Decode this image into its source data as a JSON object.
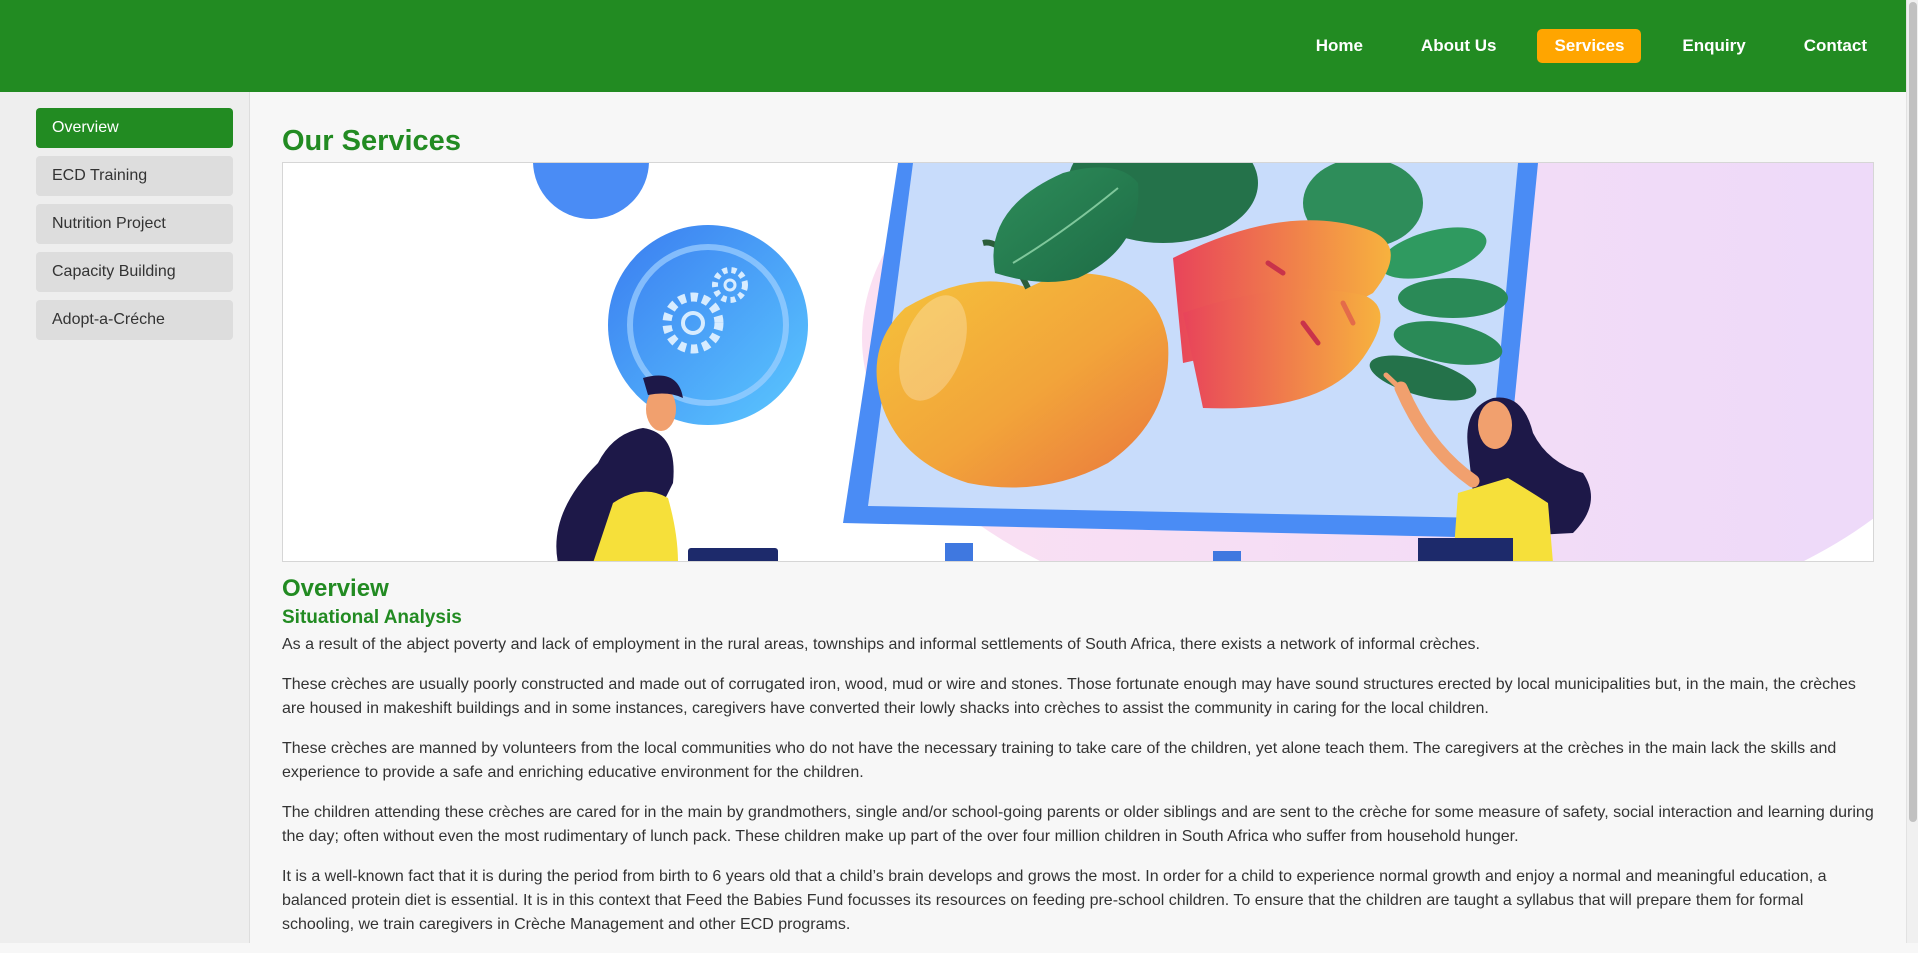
{
  "nav": {
    "items": [
      {
        "label": "Home",
        "active": false
      },
      {
        "label": "About Us",
        "active": false
      },
      {
        "label": "Services",
        "active": true
      },
      {
        "label": "Enquiry",
        "active": false
      },
      {
        "label": "Contact",
        "active": false
      }
    ]
  },
  "sidebar": {
    "items": [
      {
        "label": "Overview",
        "active": true
      },
      {
        "label": "ECD Training",
        "active": false
      },
      {
        "label": "Nutrition Project",
        "active": false
      },
      {
        "label": "Capacity Building",
        "active": false
      },
      {
        "label": "Adopt-a-Créche",
        "active": false
      }
    ]
  },
  "main": {
    "title": "Our Services",
    "section_title": "Overview",
    "subsection_title": "Situational Analysis",
    "paragraphs": [
      "As a result of the abject poverty and lack of employment in the rural areas, townships and informal settlements of South Africa, there exists a network of informal crèches.",
      "These crèches are usually poorly constructed and made out of corrugated iron, wood, mud or wire and stones. Those fortunate enough may have sound structures erected by local municipalities but, in the main, the crèches are housed in makeshift buildings and in some instances, caregivers have converted their lowly shacks into crèches to assist the community in caring for the local children.",
      "These crèches are manned by volunteers from the local communities who do not have the necessary training to take care of the children, yet alone teach them. The caregivers at the crèches in the main lack the skills and experience to provide a safe and enriching educative environment for the children.",
      "The children attending these crèches are cared for in the main by grandmothers, single and/or school-going parents or older siblings and are sent to the crèche for some measure of safety, social interaction and learning during the day; often without even the most rudimentary of lunch pack. These children make up part of the over four million children in South Africa who suffer from household hunger.",
      "It is a well-known fact that it is during the period from birth to 6 years old that a child’s brain develops and grows the most. In order for a child to experience normal growth and enjoy a normal and meaningful education, a balanced protein diet is essential. It is in this context that Feed the Babies Fund focusses its resources on feeding pre-school children. To ensure that the children are taught a syllabus that will prepare them for formal schooling, we train caregivers in Crèche Management and other ECD programs."
    ]
  },
  "colors": {
    "brand_green": "#228b22",
    "nav_active": "#ffa500",
    "sidebar_bg": "#eeeeee",
    "sidebar_item": "#dddddd"
  },
  "banner": {
    "icons": [
      "gears-icon",
      "apple-icon",
      "carrot-icon",
      "presentation-board-icon",
      "teacher-illustration",
      "student-illustration"
    ]
  }
}
